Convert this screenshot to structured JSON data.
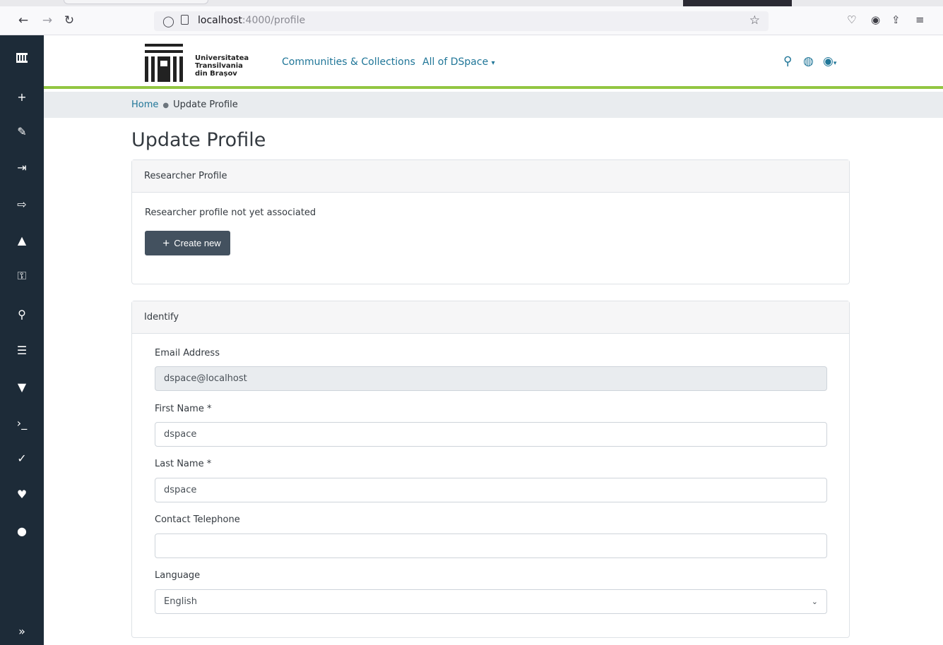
{
  "browser": {
    "url_host": "localhost",
    "url_path": ":4000/profile"
  },
  "admin_sidebar": {
    "items": [
      "plus-icon",
      "pencil-icon",
      "import-icon",
      "export-icon",
      "bell-icon",
      "key-icon",
      "search-icon",
      "list-icon",
      "filter-icon",
      "terminal-icon",
      "user-check-icon",
      "heartbeat-icon",
      "alert-icon"
    ],
    "expand_label": "»"
  },
  "header": {
    "university_line1": "Universitatea",
    "university_line2": "Transilvania",
    "university_line3": "din Brașov",
    "nav_communities": "Communities & Collections",
    "nav_all": "All of DSpace",
    "accent": "#92c642",
    "link_color": "#207698"
  },
  "breadcrumb": {
    "home": "Home",
    "current": "Update Profile"
  },
  "page_title": "Update Profile",
  "researcher_card": {
    "header": "Researcher Profile",
    "message": "Researcher profile not yet associated",
    "create_label": "Create new"
  },
  "identify_card": {
    "header": "Identify",
    "email_label": "Email Address",
    "email_value": "dspace@localhost",
    "first_name_label": "First Name *",
    "first_name_value": "dspace",
    "last_name_label": "Last Name *",
    "last_name_value": "dspace",
    "phone_label": "Contact Telephone",
    "phone_value": "",
    "language_label": "Language",
    "language_value": "English"
  }
}
